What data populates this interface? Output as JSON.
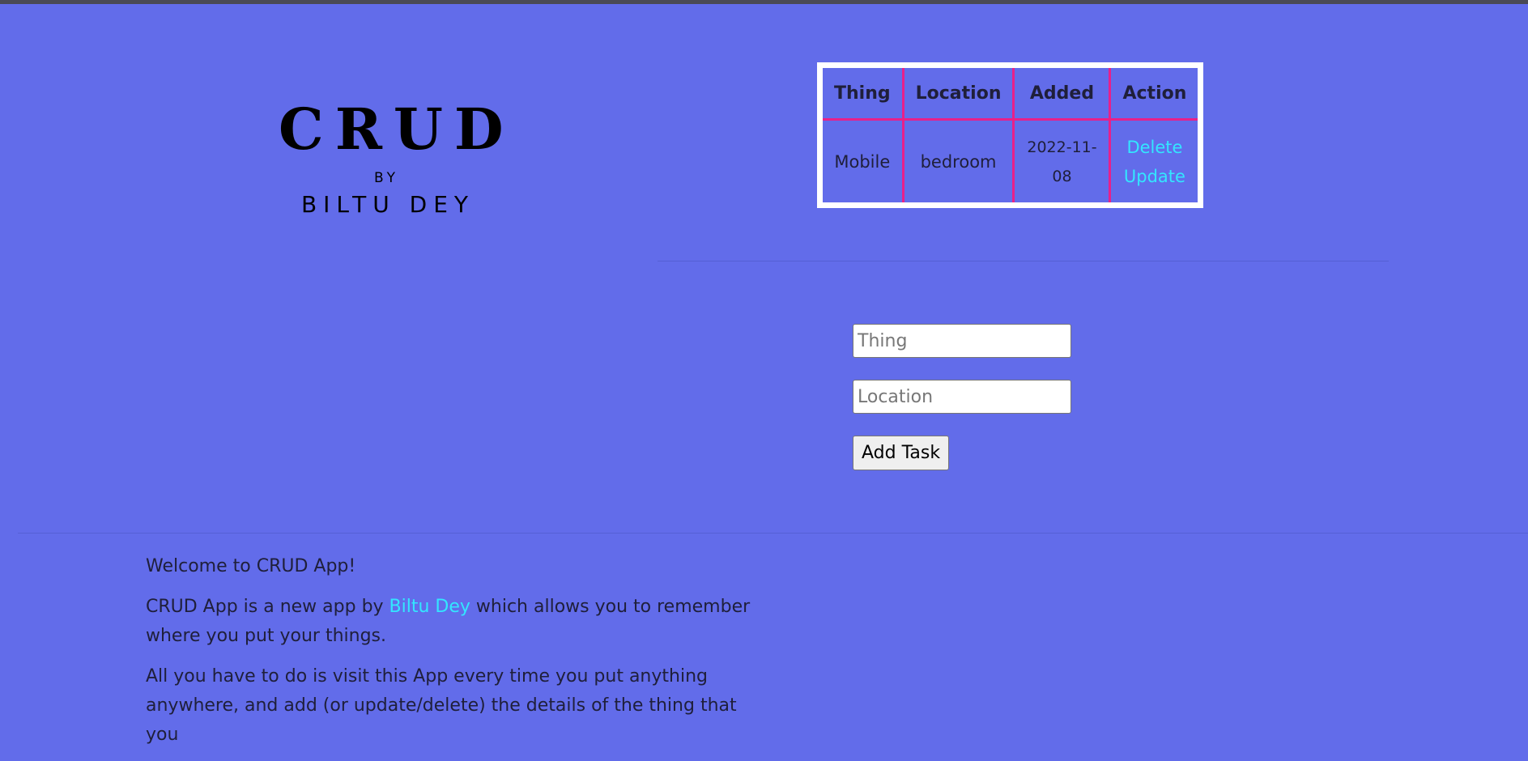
{
  "logo": {
    "title": "CRUD",
    "by": "BY",
    "author": "BILTU DEY"
  },
  "table": {
    "headers": [
      "Thing",
      "Location",
      "Added",
      "Action"
    ],
    "rows": [
      {
        "thing": "Mobile",
        "location": "bedroom",
        "added": "2022-11-08",
        "delete_label": "Delete",
        "update_label": "Update"
      }
    ]
  },
  "form": {
    "thing_placeholder": "Thing",
    "location_placeholder": "Location",
    "add_button_label": "Add Task"
  },
  "about": {
    "welcome": "Welcome to CRUD App!",
    "intro_before": "CRUD App is a new app by ",
    "intro_link": "Biltu Dey",
    "intro_after": " which allows you to remember where you put your things.",
    "instructions": "All you have to do is visit this App every time you put anything anywhere, and add (or update/delete) the details of the thing that you"
  },
  "colors": {
    "background": "#626cea",
    "table_border": "#e8208a",
    "link": "#33e6ff"
  }
}
